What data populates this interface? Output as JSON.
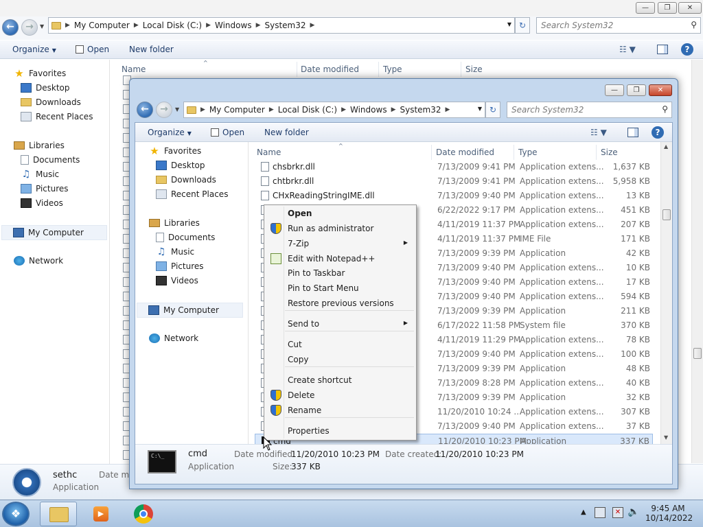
{
  "back_window": {
    "breadcrumb": [
      "My Computer",
      "Local Disk (C:)",
      "Windows",
      "System32"
    ],
    "search_placeholder": "Search System32",
    "toolbar": {
      "organize": "Organize",
      "open": "Open",
      "new_folder": "New folder"
    },
    "nav": {
      "favorites": "Favorites",
      "desktop": "Desktop",
      "downloads": "Downloads",
      "recent_places": "Recent Places",
      "libraries": "Libraries",
      "documents": "Documents",
      "music": "Music",
      "pictures": "Pictures",
      "videos": "Videos",
      "my_computer": "My Computer",
      "network": "Network"
    },
    "columns": {
      "name": "Name",
      "date_modified": "Date modified",
      "type": "Type",
      "size": "Size"
    },
    "details": {
      "name": "sethc",
      "type": "Application",
      "date_label": "Date mo"
    }
  },
  "front_window": {
    "breadcrumb": [
      "My Computer",
      "Local Disk (C:)",
      "Windows",
      "System32"
    ],
    "search_placeholder": "Search System32",
    "toolbar": {
      "organize": "Organize",
      "open": "Open",
      "new_folder": "New folder"
    },
    "nav": {
      "favorites": "Favorites",
      "desktop": "Desktop",
      "downloads": "Downloads",
      "recent_places": "Recent Places",
      "libraries": "Libraries",
      "documents": "Documents",
      "music": "Music",
      "pictures": "Pictures",
      "videos": "Videos",
      "my_computer": "My Computer",
      "network": "Network"
    },
    "columns": {
      "name": "Name",
      "date_modified": "Date modified",
      "type": "Type",
      "size": "Size"
    },
    "files": [
      {
        "name": "chsbrkr.dll",
        "date": "7/13/2009 9:41 PM",
        "type": "Application extens...",
        "size": "1,637 KB"
      },
      {
        "name": "chtbrkr.dll",
        "date": "7/13/2009 9:41 PM",
        "type": "Application extens...",
        "size": "5,958 KB"
      },
      {
        "name": "CHxReadingStringIME.dll",
        "date": "7/13/2009 9:40 PM",
        "type": "Application extens...",
        "size": "13 KB"
      },
      {
        "name": "",
        "date": "6/22/2022 9:17 PM",
        "type": "Application extens...",
        "size": "451 KB"
      },
      {
        "name": "",
        "date": "4/11/2019 11:37 PM",
        "type": "Application extens...",
        "size": "207 KB"
      },
      {
        "name": "",
        "date": "4/11/2019 11:37 PM",
        "type": "IME File",
        "size": "171 KB"
      },
      {
        "name": "",
        "date": "7/13/2009 9:39 PM",
        "type": "Application",
        "size": "42 KB"
      },
      {
        "name": "",
        "date": "7/13/2009 9:40 PM",
        "type": "Application extens...",
        "size": "10 KB"
      },
      {
        "name": "",
        "date": "7/13/2009 9:40 PM",
        "type": "Application extens...",
        "size": "17 KB"
      },
      {
        "name": "",
        "date": "7/13/2009 9:40 PM",
        "type": "Application extens...",
        "size": "594 KB"
      },
      {
        "name": "",
        "date": "7/13/2009 9:39 PM",
        "type": "Application",
        "size": "211 KB"
      },
      {
        "name": "",
        "date": "6/17/2022 11:58 PM",
        "type": "System file",
        "size": "370 KB"
      },
      {
        "name": "",
        "date": "4/11/2019 11:29 PM",
        "type": "Application extens...",
        "size": "78 KB"
      },
      {
        "name": "",
        "date": "7/13/2009 9:40 PM",
        "type": "Application extens...",
        "size": "100 KB"
      },
      {
        "name": "",
        "date": "7/13/2009 9:39 PM",
        "type": "Application",
        "size": "48 KB"
      },
      {
        "name": "",
        "date": "7/13/2009 8:28 PM",
        "type": "Application extens...",
        "size": "40 KB"
      },
      {
        "name": "",
        "date": "7/13/2009 9:39 PM",
        "type": "Application",
        "size": "32 KB"
      },
      {
        "name": "",
        "date": "11/20/2010 10:24 ...",
        "type": "Application extens...",
        "size": "307 KB"
      },
      {
        "name": "",
        "date": "7/13/2009 9:40 PM",
        "type": "Application extens...",
        "size": "37 KB"
      },
      {
        "name": "cmd",
        "date": "11/20/2010 10:23 PM",
        "type": "Application",
        "size": "337 KB"
      }
    ],
    "details": {
      "name": "cmd",
      "type": "Application",
      "date_modified_label": "Date modified:",
      "date_modified": "11/20/2010 10:23 PM",
      "date_created_label": "Date created:",
      "date_created": "11/20/2010 10:23 PM",
      "size_label": "Size:",
      "size": "337 KB"
    }
  },
  "context_menu": [
    {
      "label": "Open",
      "bold": true
    },
    {
      "label": "Run as administrator",
      "icon": "shield-icon"
    },
    {
      "label": "7-Zip",
      "submenu": true
    },
    {
      "label": "Edit with Notepad++",
      "icon": "notepadpp-icon"
    },
    {
      "label": "Pin to Taskbar"
    },
    {
      "label": "Pin to Start Menu"
    },
    {
      "label": "Restore previous versions"
    },
    {
      "label": "Send to",
      "submenu": true
    },
    {
      "label": "Cut"
    },
    {
      "label": "Copy"
    },
    {
      "label": "Create shortcut"
    },
    {
      "label": "Delete",
      "icon": "shield-icon"
    },
    {
      "label": "Rename",
      "icon": "shield-icon"
    },
    {
      "label": "Properties"
    }
  ],
  "taskbar": {
    "time": "9:45 AM",
    "date": "10/14/2022"
  },
  "colors": {
    "selection": "#d9e8fb",
    "accent": "#2f6bb3",
    "taskbar": "#b8d0ea"
  }
}
